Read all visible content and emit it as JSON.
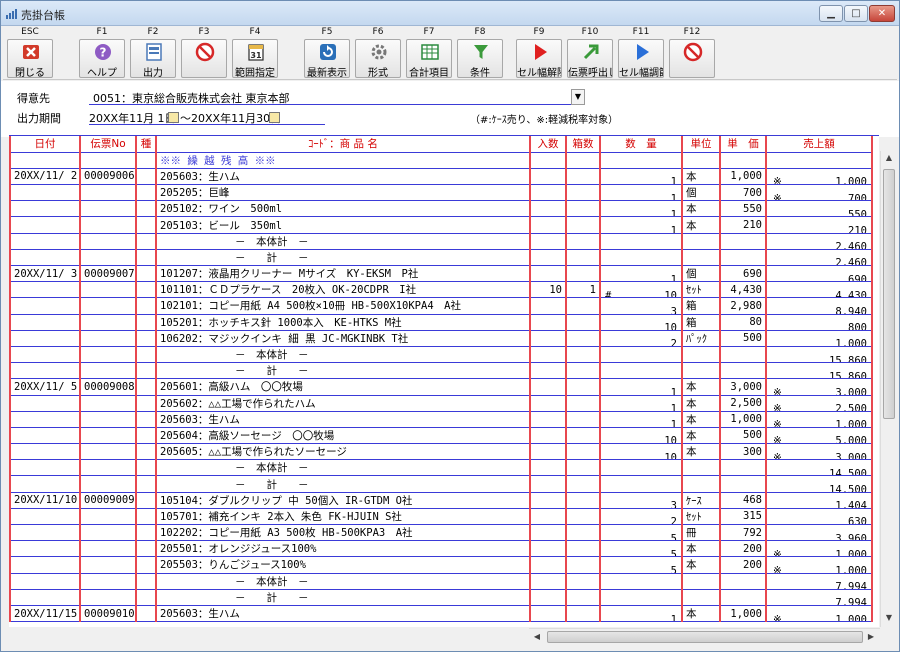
{
  "window": {
    "title": "売掛台帳"
  },
  "toolbar": {
    "keys": [
      {
        "key": "ESC",
        "name": "閉じる",
        "icon": "close-x-icon",
        "color": "#d23a2a"
      },
      {
        "key": "F1",
        "name": "ヘルプ",
        "icon": "help-icon",
        "color": "#8e5bc4"
      },
      {
        "key": "F2",
        "name": "出力",
        "icon": "print-icon",
        "color": "#4a79b8"
      },
      {
        "key": "F3",
        "name": "",
        "icon": "disabled-icon",
        "color": "#d62828"
      },
      {
        "key": "F4",
        "name": "範囲指定",
        "icon": "calendar-icon",
        "color": "#2a2a2a"
      },
      {
        "key": "F5",
        "name": "最新表示",
        "icon": "refresh-icon",
        "color": "#2a6fb8"
      },
      {
        "key": "F6",
        "name": "形式",
        "icon": "gear-icon",
        "color": "#777777"
      },
      {
        "key": "F7",
        "name": "合計項目",
        "icon": "spreadsheet-icon",
        "color": "#2b8a3e"
      },
      {
        "key": "F8",
        "name": "条件",
        "icon": "filter-icon",
        "color": "#3b9a3b"
      },
      {
        "key": "F9",
        "name": "セル幅解除",
        "icon": "play-red-icon",
        "color": "#e02020"
      },
      {
        "key": "F10",
        "name": "伝票呼出し",
        "icon": "arrow-up-right-icon",
        "color": "#3a9a3a"
      },
      {
        "key": "F11",
        "name": "セル幅調節",
        "icon": "play-blue-icon",
        "color": "#2a6fd8"
      },
      {
        "key": "F12",
        "name": "",
        "icon": "disabled-icon",
        "color": "#d62828"
      }
    ]
  },
  "form": {
    "customer_label": "得意先",
    "customer_value": "0051：東京総合販売株式会社 東京本部",
    "period_label": "出力期間",
    "period_from": "20XX年11月 1日",
    "period_sep": "～",
    "period_to": "20XX年11月30日",
    "legend": "（#:ｹｰｽ売り、※:軽減税率対象）"
  },
  "grid": {
    "headers": {
      "date": "日付",
      "no": "伝票No",
      "type": "種",
      "item": "ｺｰﾄﾞ：商 品 名",
      "per_box": "入数",
      "boxes": "箱数",
      "qty": "数　量",
      "unit": "単位",
      "price": "単　価",
      "amount": "売上額"
    },
    "rows": [
      {
        "date": "",
        "no": "",
        "type": "",
        "item": "※※ 繰 越 残 高 ※※",
        "kind": "carry",
        "per": "",
        "box": "",
        "mark": "",
        "qty": "",
        "unit": "",
        "price": "",
        "tax": "",
        "amount": ""
      },
      {
        "date": "20XX/11/ 2",
        "no": "00009006",
        "type": "",
        "item": "205603：生ハム",
        "kind": "line",
        "per": "",
        "box": "",
        "mark": "",
        "qty": "1",
        "unit": "本",
        "price": "1,000",
        "tax": "※",
        "amount": "1,000"
      },
      {
        "date": "",
        "no": "",
        "type": "",
        "item": "205205：巨峰",
        "kind": "line",
        "per": "",
        "box": "",
        "mark": "",
        "qty": "1",
        "unit": "個",
        "price": "700",
        "tax": "※",
        "amount": "700"
      },
      {
        "date": "",
        "no": "",
        "type": "",
        "item": "205102：ワイン　500ml",
        "kind": "line",
        "per": "",
        "box": "",
        "mark": "",
        "qty": "1",
        "unit": "本",
        "price": "550",
        "tax": "",
        "amount": "550"
      },
      {
        "date": "",
        "no": "",
        "type": "",
        "item": "205103：ビール　350ml",
        "kind": "line",
        "per": "",
        "box": "",
        "mark": "",
        "qty": "1",
        "unit": "本",
        "price": "210",
        "tax": "",
        "amount": "210"
      },
      {
        "date": "",
        "no": "",
        "type": "",
        "item": "－　本体計　－",
        "kind": "sub",
        "per": "",
        "box": "",
        "mark": "",
        "qty": "",
        "unit": "",
        "price": "",
        "tax": "",
        "amount": "2,460"
      },
      {
        "date": "",
        "no": "",
        "type": "",
        "item": "－　　計　　－",
        "kind": "sub",
        "per": "",
        "box": "",
        "mark": "",
        "qty": "",
        "unit": "",
        "price": "",
        "tax": "",
        "amount": "2,460"
      },
      {
        "date": "20XX/11/ 3",
        "no": "00009007",
        "type": "",
        "item": "101207：液晶用クリーナー Mサイズ　KY-EKSM　P社",
        "kind": "line",
        "per": "",
        "box": "",
        "mark": "",
        "qty": "1",
        "unit": "個",
        "price": "690",
        "tax": "",
        "amount": "690"
      },
      {
        "date": "",
        "no": "",
        "type": "",
        "item": "101101：ＣＤプラケース　20枚入 OK-20CDPR　I社",
        "kind": "line",
        "per": "10",
        "box": "1",
        "mark": "#",
        "qty": "10",
        "unit": "ｾｯﾄ",
        "price": "4,430",
        "tax": "",
        "amount": "4,430"
      },
      {
        "date": "",
        "no": "",
        "type": "",
        "item": "102101：コピー用紙 A4 500枚×10冊 HB-500X10KPA4　A社",
        "kind": "line",
        "per": "",
        "box": "",
        "mark": "",
        "qty": "3",
        "unit": "箱",
        "price": "2,980",
        "tax": "",
        "amount": "8,940"
      },
      {
        "date": "",
        "no": "",
        "type": "",
        "item": "105201：ホッチキス針 1000本入　KE-HTKS M社",
        "kind": "line",
        "per": "",
        "box": "",
        "mark": "",
        "qty": "10",
        "unit": "箱",
        "price": "80",
        "tax": "",
        "amount": "800"
      },
      {
        "date": "",
        "no": "",
        "type": "",
        "item": "106202：マジックインキ 細 黒 JC-MGKINBK T社",
        "kind": "line",
        "per": "",
        "box": "",
        "mark": "",
        "qty": "2",
        "unit": "ﾊﾟｯｸ",
        "price": "500",
        "tax": "",
        "amount": "1,000"
      },
      {
        "date": "",
        "no": "",
        "type": "",
        "item": "－　本体計　－",
        "kind": "sub",
        "per": "",
        "box": "",
        "mark": "",
        "qty": "",
        "unit": "",
        "price": "",
        "tax": "",
        "amount": "15,860"
      },
      {
        "date": "",
        "no": "",
        "type": "",
        "item": "－　　計　　－",
        "kind": "sub",
        "per": "",
        "box": "",
        "mark": "",
        "qty": "",
        "unit": "",
        "price": "",
        "tax": "",
        "amount": "15,860"
      },
      {
        "date": "20XX/11/ 5",
        "no": "00009008",
        "type": "",
        "item": "205601：高級ハム　〇〇牧場",
        "kind": "line",
        "per": "",
        "box": "",
        "mark": "",
        "qty": "1",
        "unit": "本",
        "price": "3,000",
        "tax": "※",
        "amount": "3,000"
      },
      {
        "date": "",
        "no": "",
        "type": "",
        "item": "205602：△△工場で作られたハム",
        "kind": "line",
        "per": "",
        "box": "",
        "mark": "",
        "qty": "1",
        "unit": "本",
        "price": "2,500",
        "tax": "※",
        "amount": "2,500"
      },
      {
        "date": "",
        "no": "",
        "type": "",
        "item": "205603：生ハム",
        "kind": "line",
        "per": "",
        "box": "",
        "mark": "",
        "qty": "1",
        "unit": "本",
        "price": "1,000",
        "tax": "※",
        "amount": "1,000"
      },
      {
        "date": "",
        "no": "",
        "type": "",
        "item": "205604：高級ソーセージ　〇〇牧場",
        "kind": "line",
        "per": "",
        "box": "",
        "mark": "",
        "qty": "10",
        "unit": "本",
        "price": "500",
        "tax": "※",
        "amount": "5,000"
      },
      {
        "date": "",
        "no": "",
        "type": "",
        "item": "205605：△△工場で作られたソーセージ",
        "kind": "line",
        "per": "",
        "box": "",
        "mark": "",
        "qty": "10",
        "unit": "本",
        "price": "300",
        "tax": "※",
        "amount": "3,000"
      },
      {
        "date": "",
        "no": "",
        "type": "",
        "item": "－　本体計　－",
        "kind": "sub",
        "per": "",
        "box": "",
        "mark": "",
        "qty": "",
        "unit": "",
        "price": "",
        "tax": "",
        "amount": "14,500"
      },
      {
        "date": "",
        "no": "",
        "type": "",
        "item": "－　　計　　－",
        "kind": "sub",
        "per": "",
        "box": "",
        "mark": "",
        "qty": "",
        "unit": "",
        "price": "",
        "tax": "",
        "amount": "14,500"
      },
      {
        "date": "20XX/11/10",
        "no": "00009009",
        "type": "",
        "item": "105104：ダブルクリップ 中 50個入 IR-GTDM O社",
        "kind": "line",
        "per": "",
        "box": "",
        "mark": "",
        "qty": "3",
        "unit": "ｹｰｽ",
        "price": "468",
        "tax": "",
        "amount": "1,404"
      },
      {
        "date": "",
        "no": "",
        "type": "",
        "item": "105701：補充インキ 2本入 朱色 FK-HJUIN S社",
        "kind": "line",
        "per": "",
        "box": "",
        "mark": "",
        "qty": "2",
        "unit": "ｾｯﾄ",
        "price": "315",
        "tax": "",
        "amount": "630"
      },
      {
        "date": "",
        "no": "",
        "type": "",
        "item": "102202：コピー用紙 A3 500枚 HB-500KPA3　A社",
        "kind": "line",
        "per": "",
        "box": "",
        "mark": "",
        "qty": "5",
        "unit": "冊",
        "price": "792",
        "tax": "",
        "amount": "3,960"
      },
      {
        "date": "",
        "no": "",
        "type": "",
        "item": "205501：オレンジジュース100%",
        "kind": "line",
        "per": "",
        "box": "",
        "mark": "",
        "qty": "5",
        "unit": "本",
        "price": "200",
        "tax": "※",
        "amount": "1,000"
      },
      {
        "date": "",
        "no": "",
        "type": "",
        "item": "205503：りんごジュース100%",
        "kind": "line",
        "per": "",
        "box": "",
        "mark": "",
        "qty": "5",
        "unit": "本",
        "price": "200",
        "tax": "※",
        "amount": "1,000"
      },
      {
        "date": "",
        "no": "",
        "type": "",
        "item": "－　本体計　－",
        "kind": "sub",
        "per": "",
        "box": "",
        "mark": "",
        "qty": "",
        "unit": "",
        "price": "",
        "tax": "",
        "amount": "7,994"
      },
      {
        "date": "",
        "no": "",
        "type": "",
        "item": "－　　計　　－",
        "kind": "sub",
        "per": "",
        "box": "",
        "mark": "",
        "qty": "",
        "unit": "",
        "price": "",
        "tax": "",
        "amount": "7,994"
      },
      {
        "date": "20XX/11/15",
        "no": "00009010",
        "type": "",
        "item": "205603：生ハム",
        "kind": "line",
        "per": "",
        "box": "",
        "mark": "",
        "qty": "1",
        "unit": "本",
        "price": "1,000",
        "tax": "※",
        "amount": "1,000"
      }
    ]
  }
}
